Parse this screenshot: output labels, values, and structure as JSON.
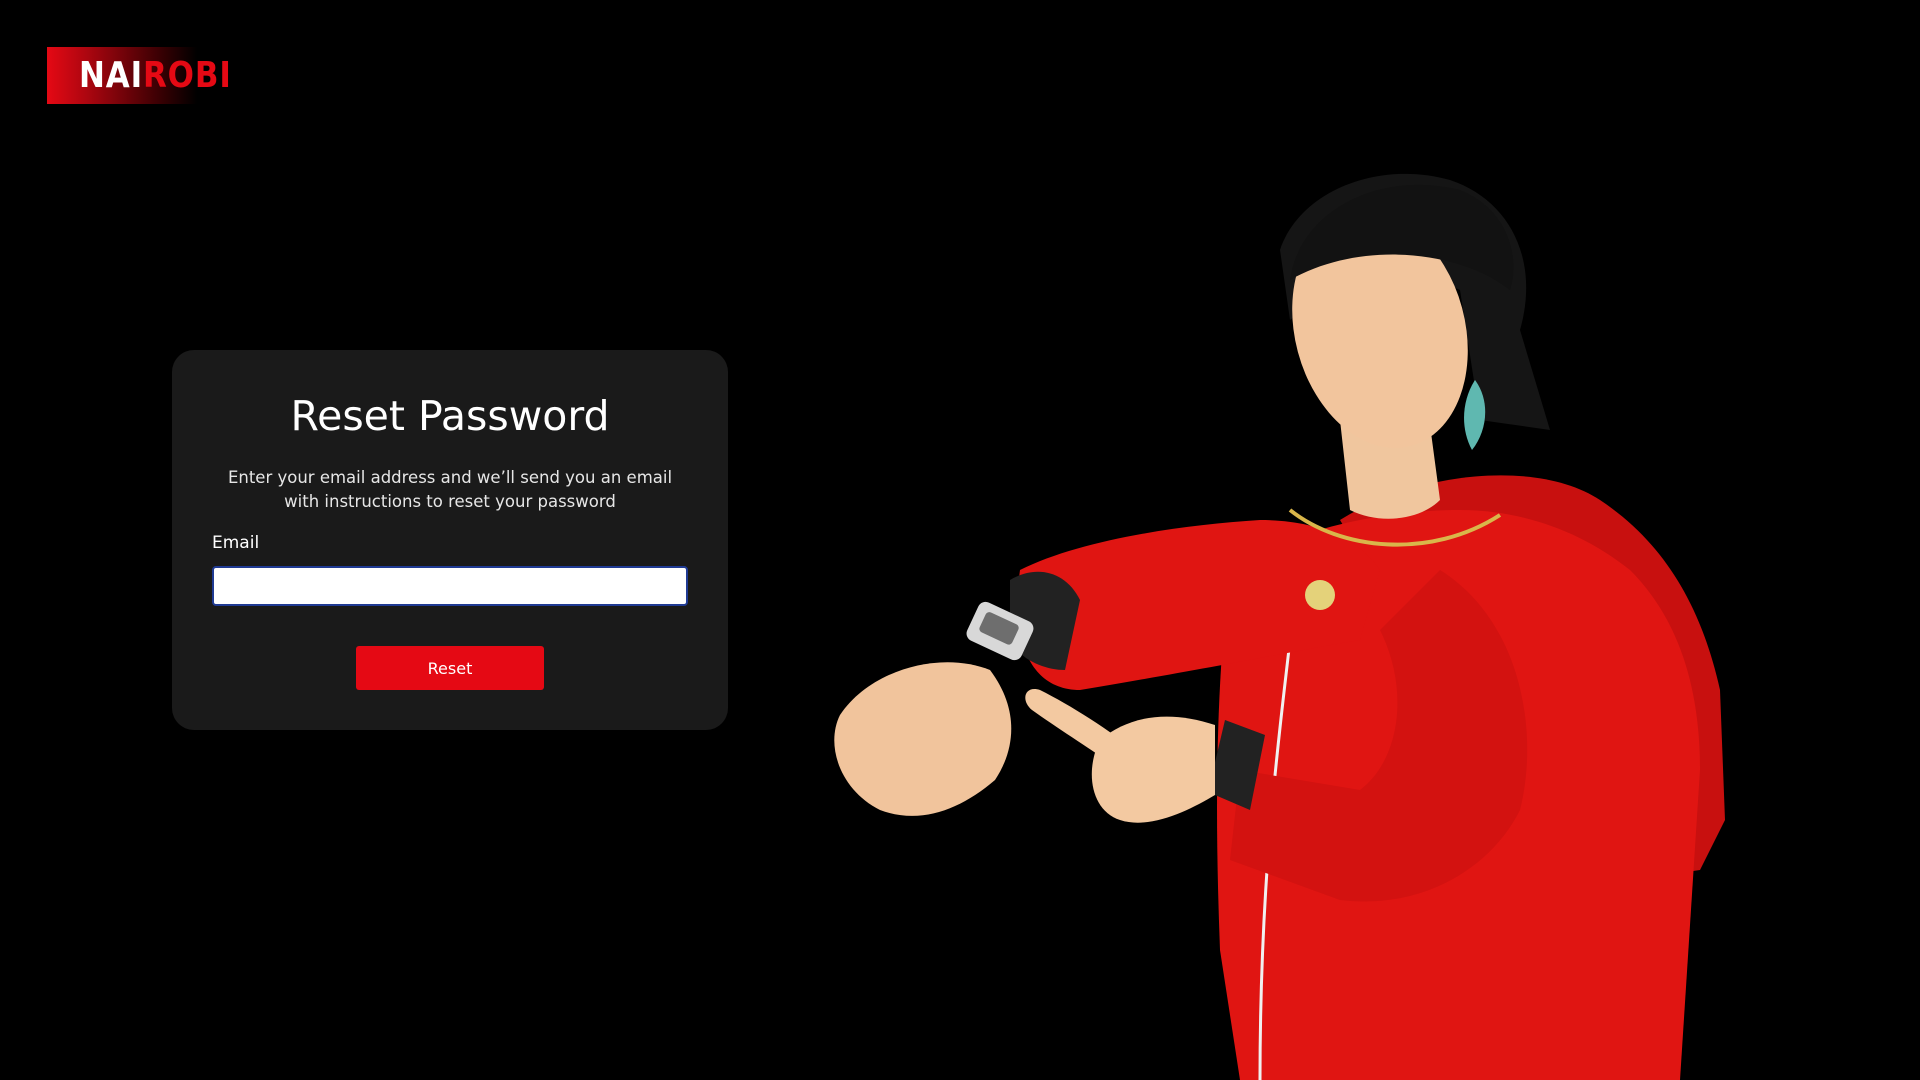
{
  "brand": {
    "logo_part_a": "NAI",
    "logo_part_b": "ROBI",
    "accent_color": "#e50914"
  },
  "reset_form": {
    "title": "Reset Password",
    "description": "Enter your email address and we’ll send you an email with instructions to reset your password",
    "email_label": "Email",
    "email_value": "",
    "email_placeholder": "",
    "submit_label": "Reset"
  },
  "illustration": {
    "icon": "character-checking-watch-illustration"
  }
}
